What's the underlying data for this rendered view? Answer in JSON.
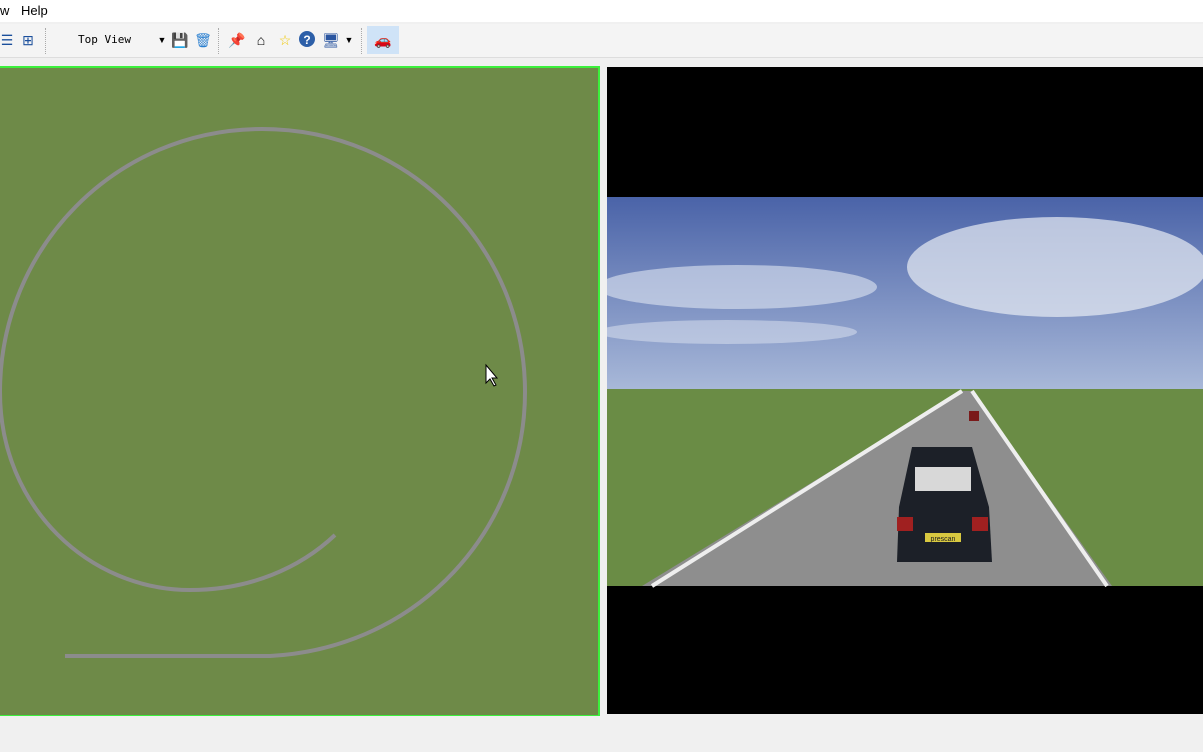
{
  "menu": {
    "items": [
      "w",
      "Help"
    ]
  },
  "toolbar": {
    "view_select": "Top View",
    "icons": [
      "layout-single-icon",
      "layout-quad-icon",
      "dropdown-arrow-icon",
      "save-icon",
      "trash-icon",
      "pin-icon",
      "house-icon",
      "star-icon",
      "help-icon",
      "monitor-icon",
      "monitor-dropdown-icon",
      "car-scene-icon"
    ]
  },
  "scene": {
    "plate_text": "prescan",
    "colors": {
      "grass": "#6e8a48",
      "viewport_border": "#3cf03c",
      "road": "#8c8c8c"
    }
  }
}
